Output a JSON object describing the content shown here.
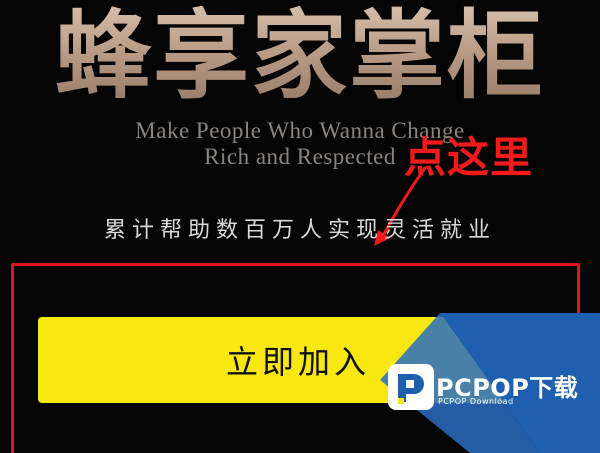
{
  "hero": {
    "title": "蜂享家掌柜",
    "slogan_line_1": "Make People Who Wanna Change",
    "slogan_line_2": "Rich and Respected",
    "subtitle": "累计帮助数百万人实现灵活就业"
  },
  "annotation": {
    "text": "点这里",
    "color": "#f21a1a"
  },
  "cta": {
    "join_label": "立即加入",
    "button_color": "#f9e712"
  },
  "watermark": {
    "name": "PCPOP下载",
    "sub": "PCPOP Download",
    "color": "#1f5fb0",
    "icon": "pcpop-logo-icon"
  }
}
